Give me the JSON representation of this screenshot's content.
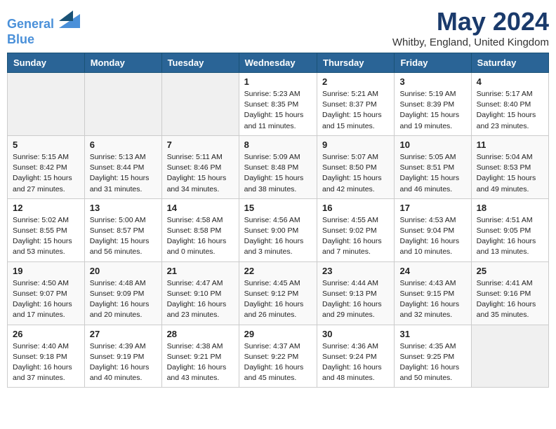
{
  "header": {
    "logo_line1": "General",
    "logo_line2": "Blue",
    "month_year": "May 2024",
    "location": "Whitby, England, United Kingdom"
  },
  "days_of_week": [
    "Sunday",
    "Monday",
    "Tuesday",
    "Wednesday",
    "Thursday",
    "Friday",
    "Saturday"
  ],
  "weeks": [
    [
      {
        "day": "",
        "info": ""
      },
      {
        "day": "",
        "info": ""
      },
      {
        "day": "",
        "info": ""
      },
      {
        "day": "1",
        "info": "Sunrise: 5:23 AM\nSunset: 8:35 PM\nDaylight: 15 hours\nand 11 minutes."
      },
      {
        "day": "2",
        "info": "Sunrise: 5:21 AM\nSunset: 8:37 PM\nDaylight: 15 hours\nand 15 minutes."
      },
      {
        "day": "3",
        "info": "Sunrise: 5:19 AM\nSunset: 8:39 PM\nDaylight: 15 hours\nand 19 minutes."
      },
      {
        "day": "4",
        "info": "Sunrise: 5:17 AM\nSunset: 8:40 PM\nDaylight: 15 hours\nand 23 minutes."
      }
    ],
    [
      {
        "day": "5",
        "info": "Sunrise: 5:15 AM\nSunset: 8:42 PM\nDaylight: 15 hours\nand 27 minutes."
      },
      {
        "day": "6",
        "info": "Sunrise: 5:13 AM\nSunset: 8:44 PM\nDaylight: 15 hours\nand 31 minutes."
      },
      {
        "day": "7",
        "info": "Sunrise: 5:11 AM\nSunset: 8:46 PM\nDaylight: 15 hours\nand 34 minutes."
      },
      {
        "day": "8",
        "info": "Sunrise: 5:09 AM\nSunset: 8:48 PM\nDaylight: 15 hours\nand 38 minutes."
      },
      {
        "day": "9",
        "info": "Sunrise: 5:07 AM\nSunset: 8:50 PM\nDaylight: 15 hours\nand 42 minutes."
      },
      {
        "day": "10",
        "info": "Sunrise: 5:05 AM\nSunset: 8:51 PM\nDaylight: 15 hours\nand 46 minutes."
      },
      {
        "day": "11",
        "info": "Sunrise: 5:04 AM\nSunset: 8:53 PM\nDaylight: 15 hours\nand 49 minutes."
      }
    ],
    [
      {
        "day": "12",
        "info": "Sunrise: 5:02 AM\nSunset: 8:55 PM\nDaylight: 15 hours\nand 53 minutes."
      },
      {
        "day": "13",
        "info": "Sunrise: 5:00 AM\nSunset: 8:57 PM\nDaylight: 15 hours\nand 56 minutes."
      },
      {
        "day": "14",
        "info": "Sunrise: 4:58 AM\nSunset: 8:58 PM\nDaylight: 16 hours\nand 0 minutes."
      },
      {
        "day": "15",
        "info": "Sunrise: 4:56 AM\nSunset: 9:00 PM\nDaylight: 16 hours\nand 3 minutes."
      },
      {
        "day": "16",
        "info": "Sunrise: 4:55 AM\nSunset: 9:02 PM\nDaylight: 16 hours\nand 7 minutes."
      },
      {
        "day": "17",
        "info": "Sunrise: 4:53 AM\nSunset: 9:04 PM\nDaylight: 16 hours\nand 10 minutes."
      },
      {
        "day": "18",
        "info": "Sunrise: 4:51 AM\nSunset: 9:05 PM\nDaylight: 16 hours\nand 13 minutes."
      }
    ],
    [
      {
        "day": "19",
        "info": "Sunrise: 4:50 AM\nSunset: 9:07 PM\nDaylight: 16 hours\nand 17 minutes."
      },
      {
        "day": "20",
        "info": "Sunrise: 4:48 AM\nSunset: 9:09 PM\nDaylight: 16 hours\nand 20 minutes."
      },
      {
        "day": "21",
        "info": "Sunrise: 4:47 AM\nSunset: 9:10 PM\nDaylight: 16 hours\nand 23 minutes."
      },
      {
        "day": "22",
        "info": "Sunrise: 4:45 AM\nSunset: 9:12 PM\nDaylight: 16 hours\nand 26 minutes."
      },
      {
        "day": "23",
        "info": "Sunrise: 4:44 AM\nSunset: 9:13 PM\nDaylight: 16 hours\nand 29 minutes."
      },
      {
        "day": "24",
        "info": "Sunrise: 4:43 AM\nSunset: 9:15 PM\nDaylight: 16 hours\nand 32 minutes."
      },
      {
        "day": "25",
        "info": "Sunrise: 4:41 AM\nSunset: 9:16 PM\nDaylight: 16 hours\nand 35 minutes."
      }
    ],
    [
      {
        "day": "26",
        "info": "Sunrise: 4:40 AM\nSunset: 9:18 PM\nDaylight: 16 hours\nand 37 minutes."
      },
      {
        "day": "27",
        "info": "Sunrise: 4:39 AM\nSunset: 9:19 PM\nDaylight: 16 hours\nand 40 minutes."
      },
      {
        "day": "28",
        "info": "Sunrise: 4:38 AM\nSunset: 9:21 PM\nDaylight: 16 hours\nand 43 minutes."
      },
      {
        "day": "29",
        "info": "Sunrise: 4:37 AM\nSunset: 9:22 PM\nDaylight: 16 hours\nand 45 minutes."
      },
      {
        "day": "30",
        "info": "Sunrise: 4:36 AM\nSunset: 9:24 PM\nDaylight: 16 hours\nand 48 minutes."
      },
      {
        "day": "31",
        "info": "Sunrise: 4:35 AM\nSunset: 9:25 PM\nDaylight: 16 hours\nand 50 minutes."
      },
      {
        "day": "",
        "info": ""
      }
    ]
  ]
}
